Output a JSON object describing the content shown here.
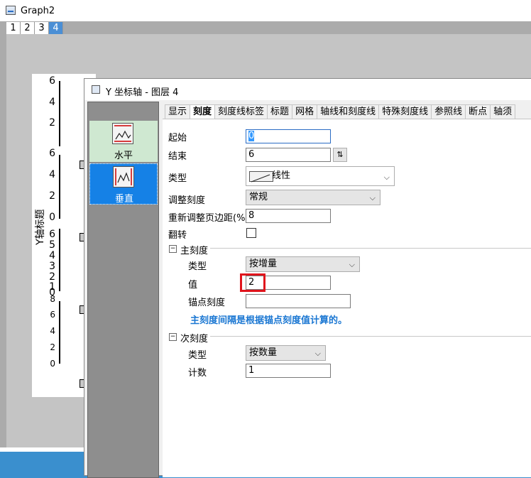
{
  "graph_window": {
    "title": "Graph2",
    "pages": [
      "1",
      "2",
      "3",
      "4"
    ],
    "active_page": "4",
    "y_axis_title": "Y轴标题",
    "layer1_ticks": [
      "6",
      "4",
      "2"
    ],
    "layer2_ticks": [
      "6",
      "4",
      "2",
      "0"
    ],
    "layer3_ticks": [
      "6",
      "5",
      "4",
      "3",
      "2",
      "1",
      "0"
    ],
    "layer4_ticks": [
      "8",
      "6",
      "4",
      "2",
      "0"
    ]
  },
  "dialog": {
    "title": "Y 坐标轴 - 图层 4",
    "side_items": [
      {
        "label": "水平"
      },
      {
        "label": "垂直"
      }
    ],
    "tabs": [
      "显示",
      "刻度",
      "刻度线标签",
      "标题",
      "网格",
      "轴线和刻度线",
      "特殊刻度线",
      "参照线",
      "断点",
      "轴须"
    ],
    "active_tab": "刻度",
    "scale": {
      "from_label": "起始",
      "from_value": "0",
      "to_label": "结束",
      "to_value": "6",
      "type_label": "类型",
      "type_value": "线性",
      "rescale_label": "调整刻度",
      "rescale_value": "常规",
      "rescale_margin_label": "重新调整页边距(%)",
      "rescale_margin_value": "8",
      "reverse_label": "翻转"
    },
    "major_ticks": {
      "section_label": "主刻度",
      "type_label": "类型",
      "type_value": "按增量",
      "value_label": "值",
      "value": "2",
      "anchor_label": "锚点刻度",
      "anchor_value": "",
      "note": "主刻度间隔是根据锚点刻度值计算的。"
    },
    "minor_ticks": {
      "section_label": "次刻度",
      "type_label": "类型",
      "type_value": "按数量",
      "count_label": "计数",
      "count_value": "1"
    }
  },
  "colors": {
    "accent_blue": "#1581e6",
    "highlight_red": "#e0141c",
    "note_blue": "#1976d2"
  }
}
